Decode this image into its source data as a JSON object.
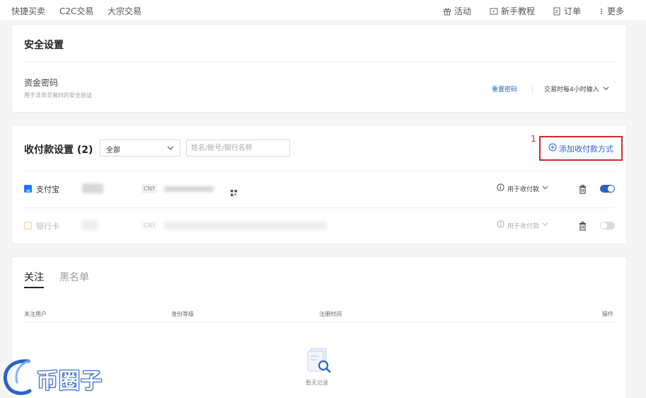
{
  "topnav": {
    "left_links": [
      "快捷买卖",
      "C2C交易",
      "大宗交易"
    ],
    "activity": "活动",
    "tutorial": "新手教程",
    "orders": "订单",
    "more": "更多"
  },
  "security": {
    "title": "安全设置",
    "fund_password_label": "资金密码",
    "fund_password_desc": "用于法币交易时的安全验证",
    "reset_link": "重置密码",
    "frequency": "交易时每4小时输入"
  },
  "payment": {
    "title": "收付款设置 (2)",
    "filter_value": "全部",
    "search_placeholder": "姓名/账号/银行名称",
    "annotation_number": "1",
    "add_button": "添加收付款方式",
    "methods": [
      {
        "name": "支付宝",
        "currency": "CNY",
        "usage": "用于收付款",
        "enabled": true,
        "icon": "alipay-icon",
        "color": "#1677ff"
      },
      {
        "name": "银行卡",
        "currency": "CNY",
        "usage": "用于收付款",
        "enabled": false,
        "icon": "bank-card-icon",
        "color": "#f0a020"
      }
    ]
  },
  "follow": {
    "tab_following": "关注",
    "tab_blacklist": "黑名单",
    "columns": [
      "关注用户",
      "身份等级",
      "注册时间",
      "操作"
    ],
    "empty_text": "暂无记录"
  },
  "watermark": {
    "text": "币圈子"
  },
  "colors": {
    "accent": "#2962c9",
    "annotation": "#d12b2b",
    "toggle_on": "#2962c9",
    "toggle_off": "#d9d9d9"
  }
}
